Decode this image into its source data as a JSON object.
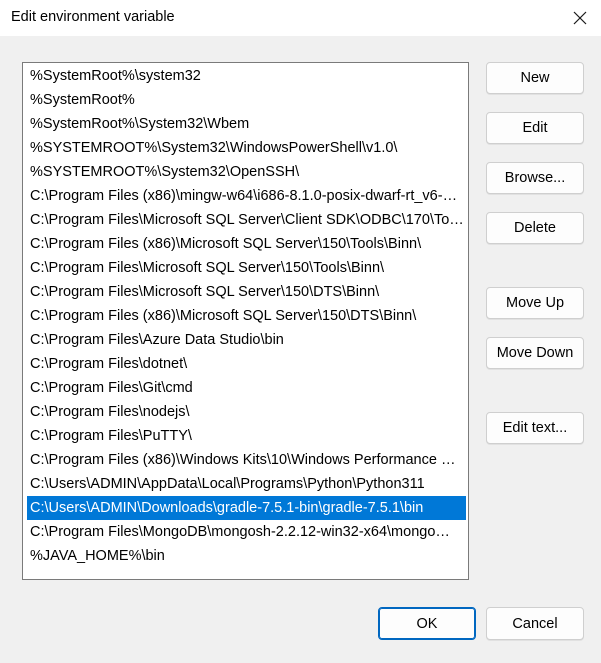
{
  "window": {
    "title": "Edit environment variable"
  },
  "list": {
    "selected_index": 18,
    "items": [
      "%SystemRoot%\\system32",
      "%SystemRoot%",
      "%SystemRoot%\\System32\\Wbem",
      "%SYSTEMROOT%\\System32\\WindowsPowerShell\\v1.0\\",
      "%SYSTEMROOT%\\System32\\OpenSSH\\",
      "C:\\Program Files (x86)\\mingw-w64\\i686-8.1.0-posix-dwarf-rt_v6-…",
      "C:\\Program Files\\Microsoft SQL Server\\Client SDK\\ODBC\\170\\To…",
      "C:\\Program Files (x86)\\Microsoft SQL Server\\150\\Tools\\Binn\\",
      "C:\\Program Files\\Microsoft SQL Server\\150\\Tools\\Binn\\",
      "C:\\Program Files\\Microsoft SQL Server\\150\\DTS\\Binn\\",
      "C:\\Program Files (x86)\\Microsoft SQL Server\\150\\DTS\\Binn\\",
      "C:\\Program Files\\Azure Data Studio\\bin",
      "C:\\Program Files\\dotnet\\",
      "C:\\Program Files\\Git\\cmd",
      "C:\\Program Files\\nodejs\\",
      "C:\\Program Files\\PuTTY\\",
      "C:\\Program Files (x86)\\Windows Kits\\10\\Windows Performance …",
      "C:\\Users\\ADMIN\\AppData\\Local\\Programs\\Python\\Python311",
      "C:\\Users\\ADMIN\\Downloads\\gradle-7.5.1-bin\\gradle-7.5.1\\bin",
      "C:\\Program Files\\MongoDB\\mongosh-2.2.12-win32-x64\\mongo…",
      "%JAVA_HOME%\\bin"
    ]
  },
  "buttons": {
    "new": "New",
    "edit": "Edit",
    "browse": "Browse...",
    "delete": "Delete",
    "move_up": "Move Up",
    "move_down": "Move Down",
    "edit_text": "Edit text...",
    "ok": "OK",
    "cancel": "Cancel"
  },
  "colors": {
    "selection": "#0078d7",
    "ok_border": "#0067c0"
  },
  "icons": {
    "close": "close-icon"
  }
}
